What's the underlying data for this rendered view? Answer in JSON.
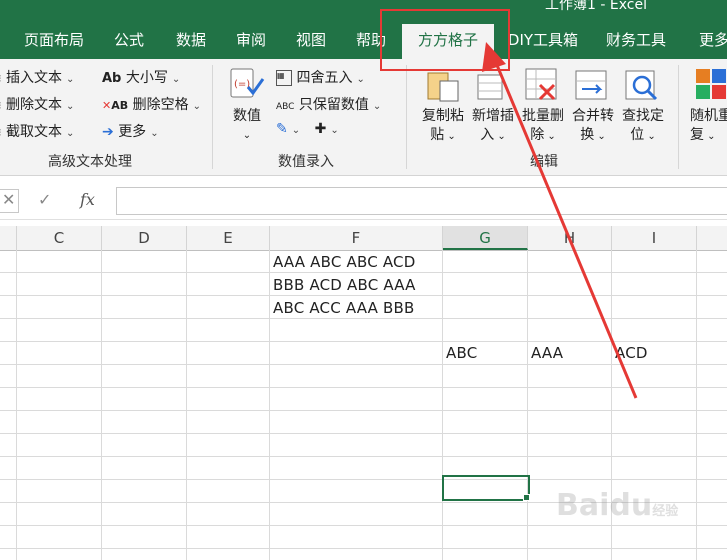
{
  "window": {
    "title": "工作簿1 - Excel"
  },
  "tabs": [
    {
      "label": "页面布局"
    },
    {
      "label": "公式"
    },
    {
      "label": "数据"
    },
    {
      "label": "审阅"
    },
    {
      "label": "视图"
    },
    {
      "label": "帮助"
    },
    {
      "label": "方方格子",
      "active": true
    },
    {
      "label": "DIY工具箱"
    },
    {
      "label": "财务工具"
    },
    {
      "label": "更多"
    }
  ],
  "ribbon": {
    "text_group": {
      "insert_text": "插入文本",
      "delete_text": "删除文本",
      "extract_text": "截取文本",
      "case": "大小写",
      "delete_spaces": "删除空格",
      "more": "更多",
      "label": "高级文本处理"
    },
    "numeric_group": {
      "numeric": "数值",
      "round": "四舍五入",
      "keep_numeric": "只保留数值",
      "label": "数值录入"
    },
    "edit_group": {
      "copy_paste": [
        "复制粘",
        "贴"
      ],
      "insert_new": [
        "新增插",
        "入"
      ],
      "batch_delete": [
        "批量删",
        "除"
      ],
      "merge_convert": [
        "合并转",
        "换"
      ],
      "find_locate": [
        "查找定",
        "位"
      ],
      "label": "编辑"
    },
    "random_group": {
      "random": [
        "随机重",
        "复"
      ]
    }
  },
  "formula_bar": {
    "fx": "fx",
    "cancel": "✕",
    "enter": "✓",
    "value": ""
  },
  "columns": [
    "C",
    "D",
    "E",
    "F",
    "G",
    "H",
    "I"
  ],
  "selected_column": "G",
  "cells": {
    "F1": "AAA  ABC  ABC  ACD",
    "F2": "BBB  ACD   ABC  AAA",
    "F3": "ABC  ACC    AAA  BBB",
    "G5": "ABC",
    "H5": "AAA",
    "I5": "ACD"
  },
  "watermark": {
    "brand": "Baidu",
    "suffix": "经验"
  },
  "colors": {
    "accent": "#217346",
    "annotation": "#e53935"
  },
  "icons": [
    "numeric-icon",
    "copy-paste-icon",
    "insert-icon",
    "batch-delete-icon",
    "merge-convert-icon",
    "find-locate-icon",
    "random-icon"
  ]
}
